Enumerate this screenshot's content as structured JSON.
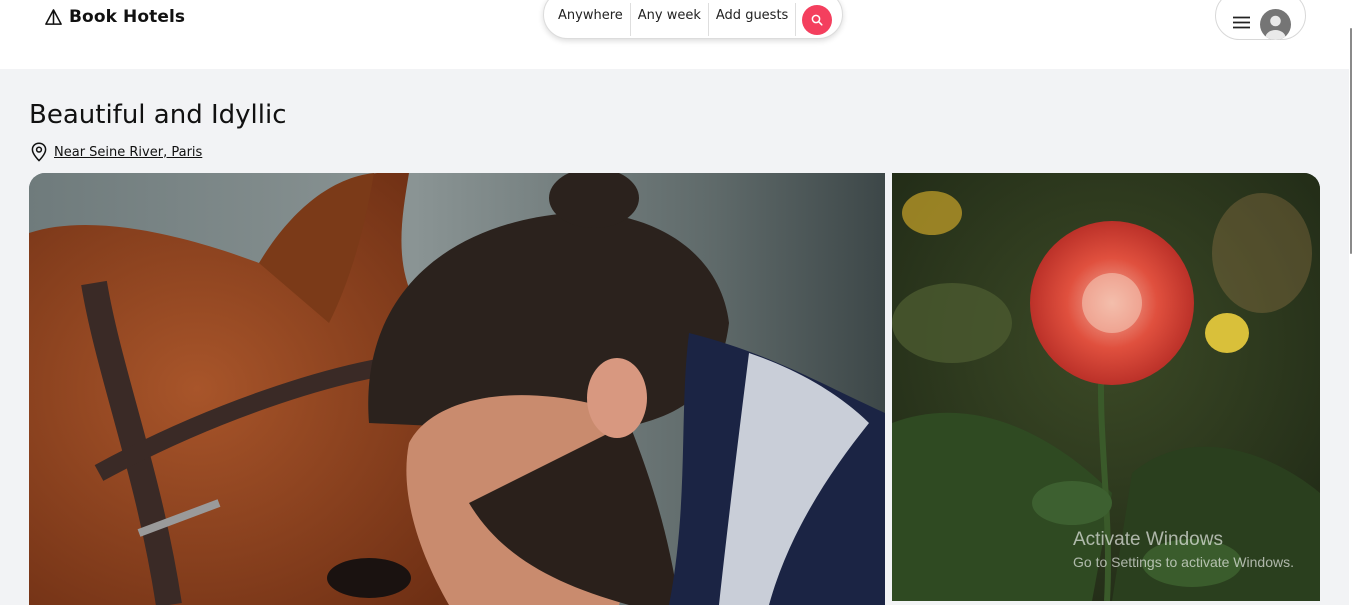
{
  "app": {
    "logo_text": "Book Hotels",
    "logo_icon": "triangle-logo-icon"
  },
  "search": {
    "where": "Anywhere",
    "when": "Any week",
    "guests": "Add guests",
    "button_icon": "search-icon",
    "accent_color": "#f43f5e"
  },
  "user_menu": {
    "menu_icon": "hamburger-icon",
    "avatar_icon": "user-avatar-icon"
  },
  "listing": {
    "title": "Beautiful and Idyllic",
    "location_icon": "map-pin-icon",
    "location": "Near Seine River, Paris",
    "photos": [
      {
        "subject": "man resting head against a brown horse"
      },
      {
        "subject": "red dahlia flower among green leaves"
      }
    ]
  },
  "watermark": {
    "line1": "Activate Windows",
    "line2": "Go to Settings to activate Windows."
  }
}
